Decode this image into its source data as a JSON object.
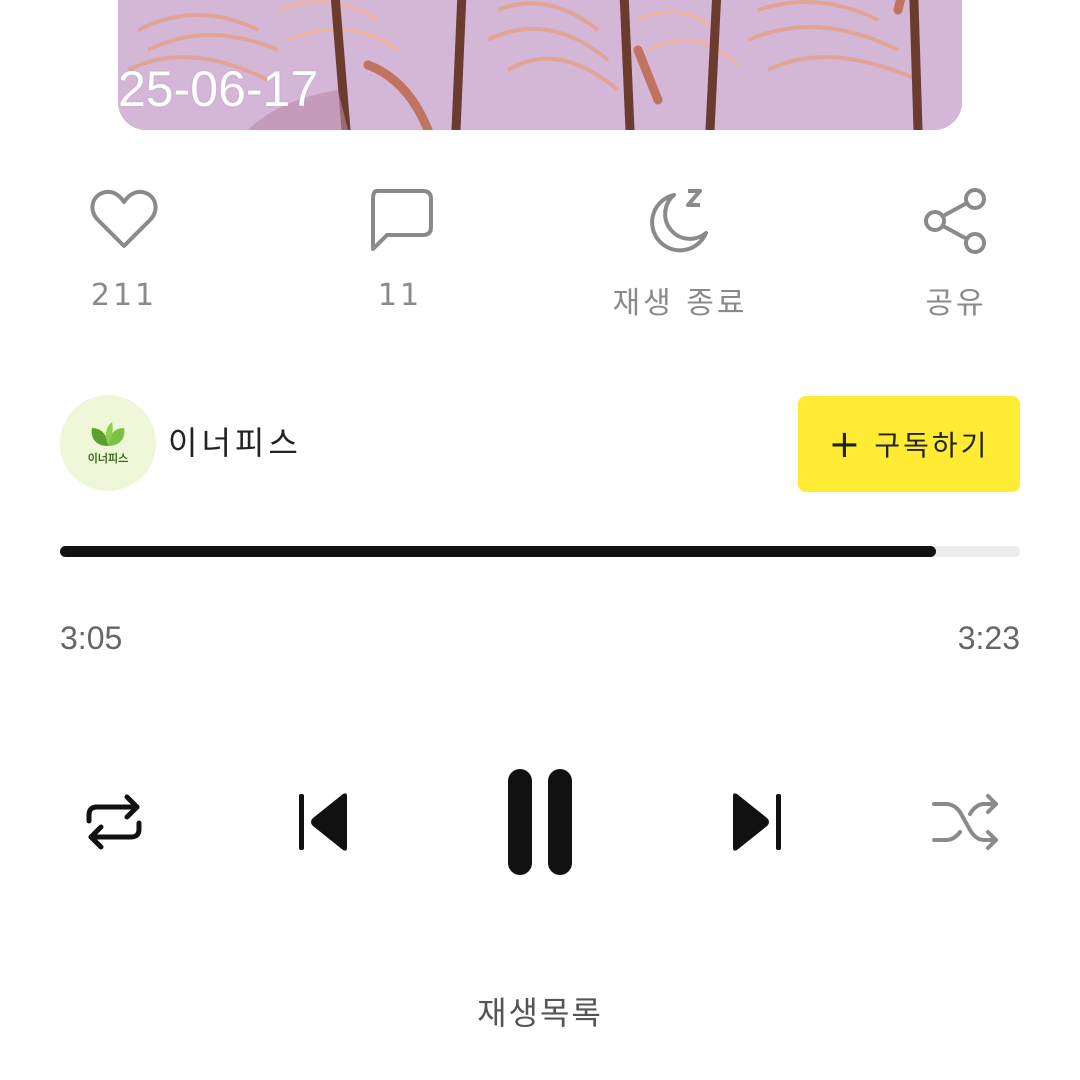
{
  "cover": {
    "date_overlay": "25-06-17"
  },
  "actions": [
    {
      "icon": "heart-icon",
      "label": "211"
    },
    {
      "icon": "comment-icon",
      "label": "11"
    },
    {
      "icon": "sleep-timer-icon",
      "label": "재생 종료"
    },
    {
      "icon": "share-icon",
      "label": "공유"
    }
  ],
  "channel": {
    "name": "이너피스",
    "avatar_text": "이너피스",
    "subscribe_label": "구독하기",
    "subscribe_plus": "+"
  },
  "player": {
    "current_time": "3:05",
    "total_time": "3:23",
    "progress": 0.912
  },
  "bottom": {
    "label": "재생목록"
  },
  "colors": {
    "accent_yellow": "#ffeb33",
    "progress": "#111111",
    "icon_gray": "#8a8a8a"
  }
}
